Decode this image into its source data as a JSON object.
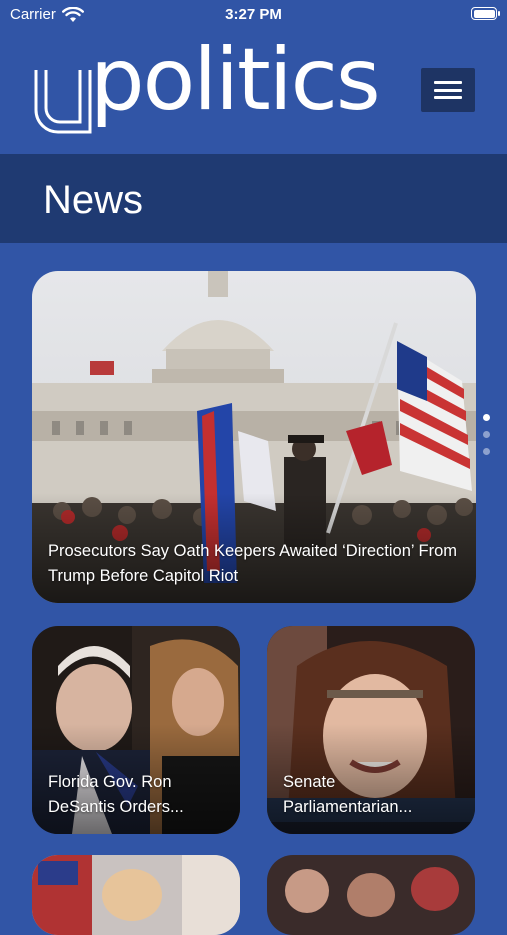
{
  "status_bar": {
    "carrier": "Carrier",
    "time": "3:27 PM",
    "battery_level": 1.0
  },
  "header": {
    "logo_text": "politics",
    "logo_letter": "u",
    "menu_icon": "hamburger-icon"
  },
  "section": {
    "title": "News"
  },
  "featured": {
    "caption": "Prosecutors Say Oath Keepers Awaited ‘Direction’ From Trump Before Capitol Riot"
  },
  "articles": [
    {
      "caption": "Florida Gov. Ron DeSantis Orders..."
    },
    {
      "caption": "Senate Parliamentarian..."
    }
  ],
  "pagination": {
    "pages": 3,
    "current": 1
  },
  "colors": {
    "background": "#3155a6",
    "band": "#1f3a72",
    "menu_button": "#1e3464"
  }
}
